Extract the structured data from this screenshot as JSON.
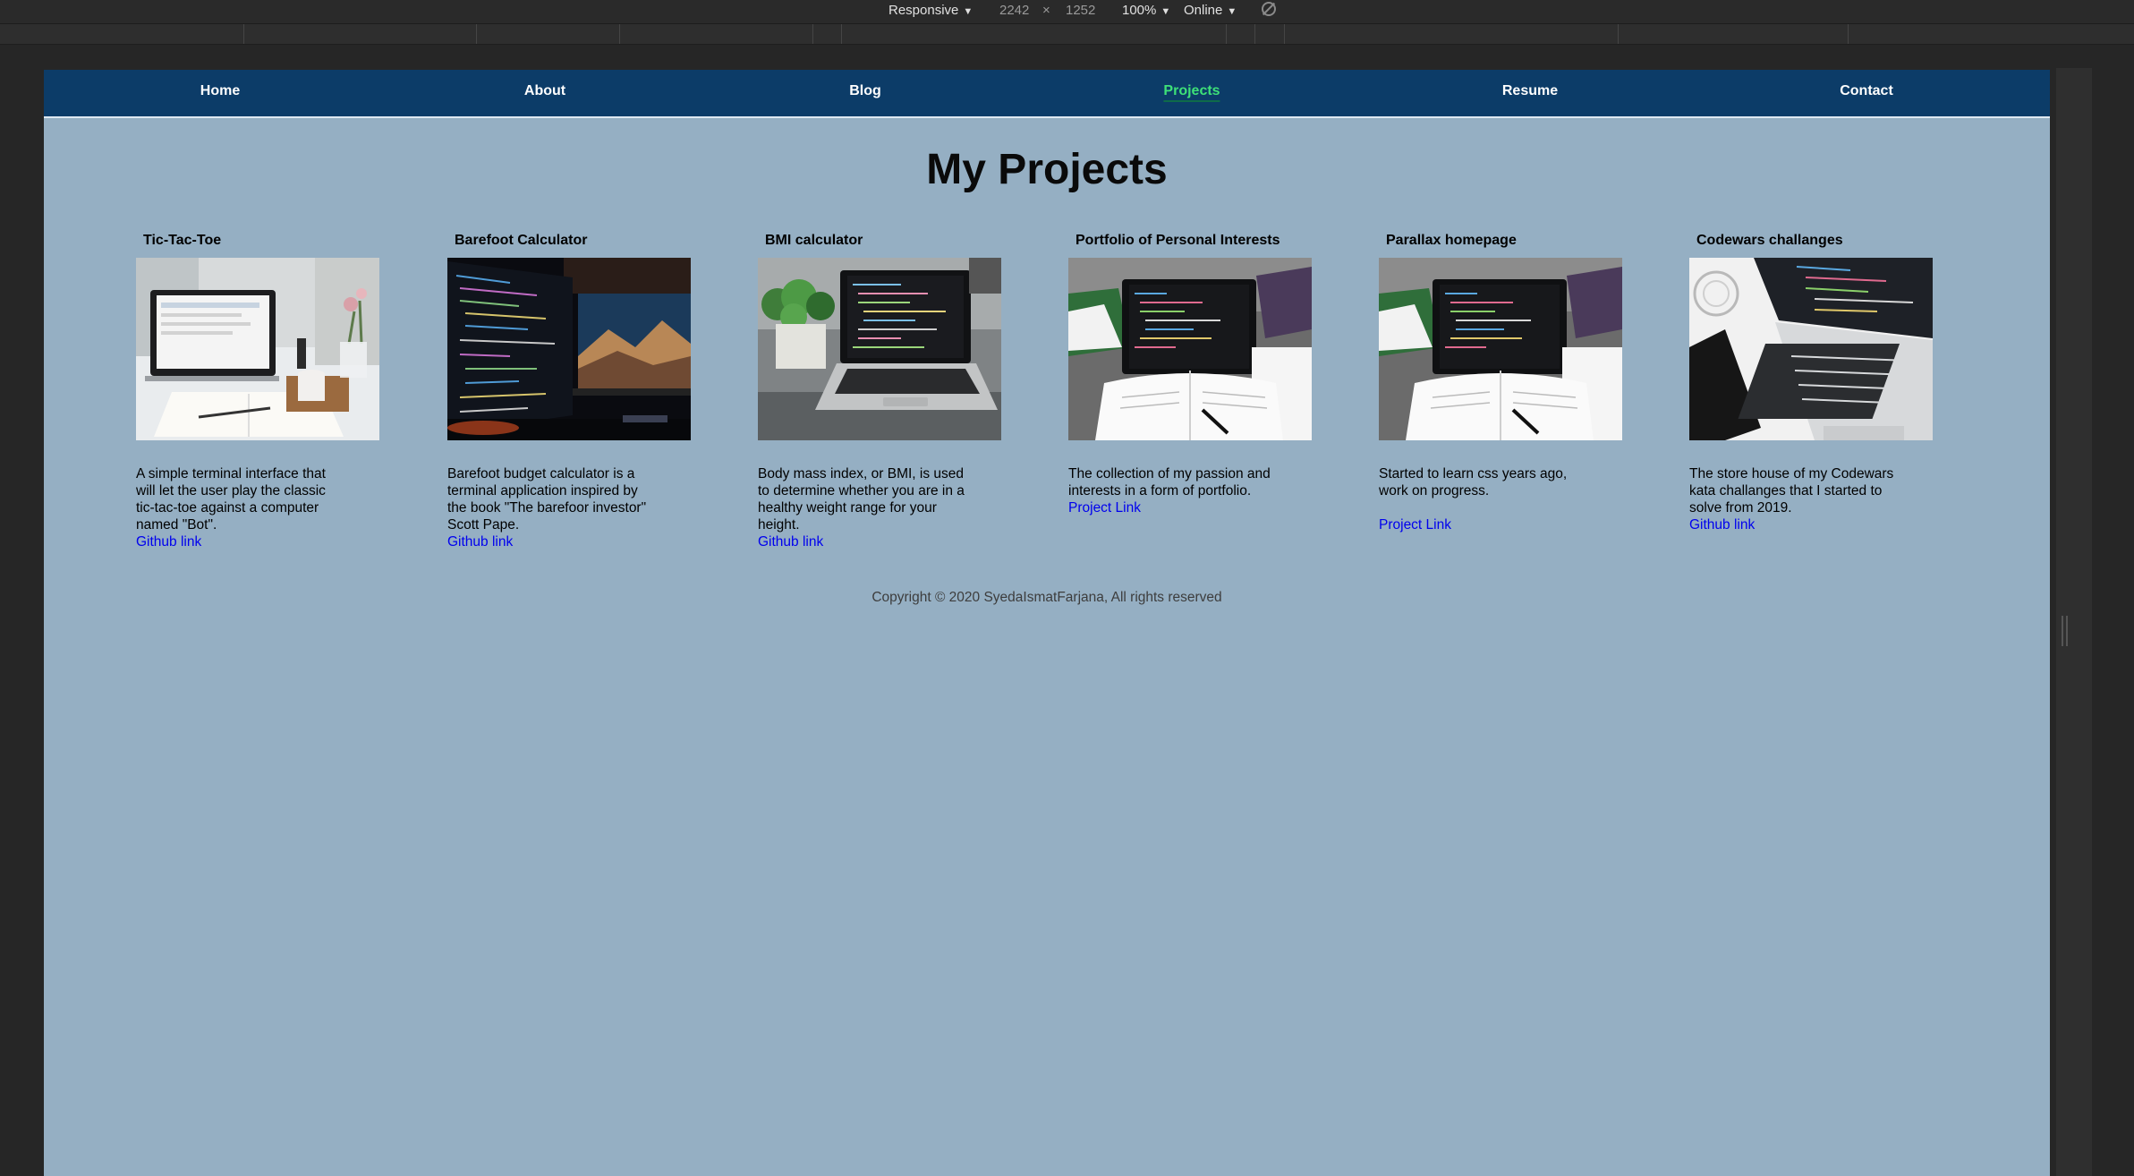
{
  "devtools": {
    "device": "Responsive",
    "width": "2242",
    "times": "×",
    "height": "1252",
    "zoom": "100%",
    "throttling": "Online"
  },
  "nav": {
    "items": [
      {
        "label": "Home"
      },
      {
        "label": "About"
      },
      {
        "label": "Blog"
      },
      {
        "label": "Projects",
        "active": true
      },
      {
        "label": "Resume"
      },
      {
        "label": "Contact"
      }
    ]
  },
  "page": {
    "title": "My Projects"
  },
  "projects": [
    {
      "title": "Tic-Tac-Toe",
      "image": "laptop-notebook-mug-photo",
      "description": "A simple terminal interface that will let the user play the classic tic-tac-toe against a computer named \"Bot\".",
      "link": "Github link"
    },
    {
      "title": "Barefoot Calculator",
      "image": "dual-monitor-code-photo",
      "description": "Barefoot budget calculator is a terminal application inspired by the book \"The barefoor investor\" Scott Pape.",
      "link": "Github link"
    },
    {
      "title": "BMI calculator",
      "image": "laptop-plant-code-photo",
      "description": "Body mass index, or BMI, is used to determine whether you are in a healthy weight range for your height.",
      "link": "Github link"
    },
    {
      "title": "Portfolio of Personal Interests",
      "image": "laptop-book-code-photo",
      "description": "The collection of my passion and interests in a form of portfolio.",
      "link": "Project Link"
    },
    {
      "title": "Parallax homepage",
      "image": "laptop-book-code-photo",
      "description": "Started to learn css years ago, work on progress.",
      "link": "Project Link"
    },
    {
      "title": "Codewars challanges",
      "image": "laptop-keyboard-code-photo",
      "description": "The store house of my Codewars kata challanges that I started to solve from 2019.",
      "link": "Github link"
    }
  ],
  "footer": {
    "copyright": "Copyright © 2020 SyedaIsmatFarjana, All rights reserved"
  },
  "colors": {
    "nav_bg": "#0c3c68",
    "page_bg": "#95afc3",
    "active_nav": "#3ee078",
    "link": "#0000ee"
  }
}
